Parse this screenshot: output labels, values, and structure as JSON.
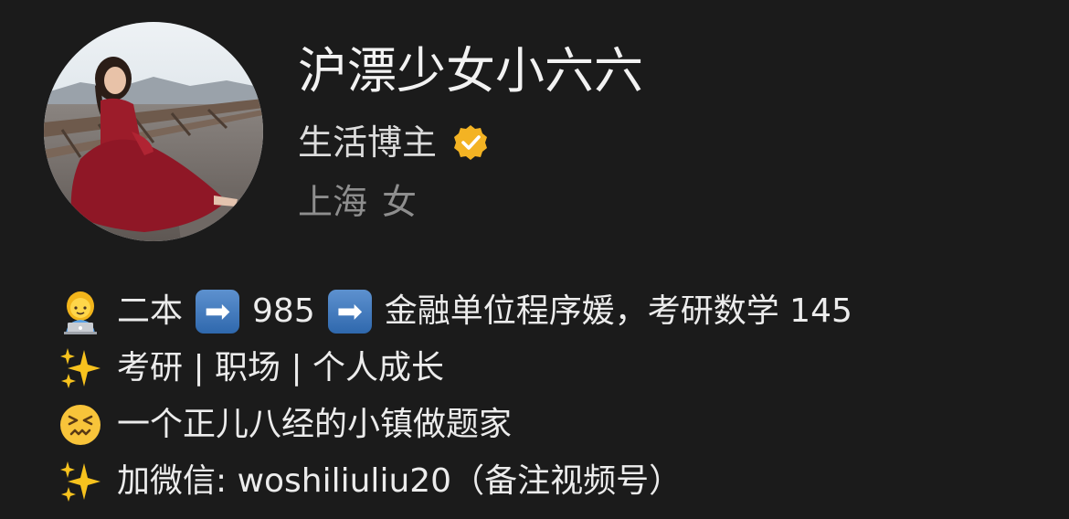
{
  "profile": {
    "name": "沪漂少女小六六",
    "role": "生活博主",
    "location": "上海",
    "gender": "女",
    "avatar_icon": "profile-photo-icon",
    "verified_icon": "verified-badge-icon",
    "colors": {
      "background": "#1b1b1b",
      "verified_badge": "#f3b323",
      "secondary_text": "#8e8e8e",
      "arrow_badge": "#3f77bc"
    }
  },
  "bio": {
    "line1": {
      "emoji": "woman-technologist-emoji",
      "part1": "二本",
      "arrow1": "➡",
      "part2": "985",
      "arrow2": "➡",
      "part3": "金融单位程序媛，考研数学 145"
    },
    "line2": {
      "emoji": "sparkles-emoji",
      "text": "考研 | 职场 | 个人成长"
    },
    "line3": {
      "emoji": "confounded-face-emoji",
      "text": "一个正儿八经的小镇做题家"
    },
    "line4": {
      "emoji": "sparkles-emoji",
      "text": "加微信: woshiliuliu20（备注视频号）"
    }
  }
}
